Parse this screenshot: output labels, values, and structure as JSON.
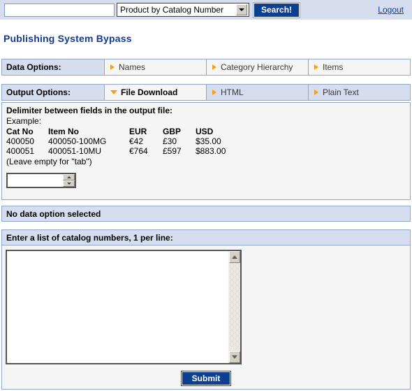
{
  "topbar": {
    "search_value": "",
    "search_placeholder": "",
    "search_category": "Product by Catalog Number",
    "search_button_label": "Search!",
    "logout_label": "Logout"
  },
  "page_title": "Publishing System Bypass",
  "data_options": {
    "label": "Data Options:",
    "items": [
      {
        "label": "Names",
        "selected": false
      },
      {
        "label": "Category Hierarchy",
        "selected": false
      },
      {
        "label": "Items",
        "selected": false
      }
    ]
  },
  "output_options": {
    "label": "Output Options:",
    "items": [
      {
        "label": "File Download",
        "selected": true
      },
      {
        "label": "HTML",
        "selected": false
      },
      {
        "label": "Plain Text",
        "selected": false
      }
    ]
  },
  "delimiter": {
    "heading": "Delimiter between fields in the output file:",
    "example_label": "Example:",
    "columns": [
      "Cat No",
      "Item No",
      "EUR",
      "GBP",
      "USD"
    ],
    "rows": [
      [
        "400050",
        "400050-100MG",
        "€42",
        "£30",
        "$35.00"
      ],
      [
        "400051",
        "400051-10MU",
        "€764",
        "£597",
        "$883.00"
      ]
    ],
    "hint": "(Leave empty for \"tab\")",
    "input_value": "",
    "input_placeholder": ""
  },
  "status": {
    "message": "No data option selected"
  },
  "catalog": {
    "header": "Enter a list of catalog numbers, 1 per line:",
    "textarea_value": "",
    "textarea_placeholder": "",
    "submit_label": "Submit"
  },
  "colors": {
    "bar_blue": "#d5ddee",
    "border_blue": "#8fa7c9",
    "title_blue": "#123a8f",
    "button_blue": "#0c3f8f",
    "bullet_orange": "#f2a116",
    "cell_white": "#f5f5f5"
  }
}
